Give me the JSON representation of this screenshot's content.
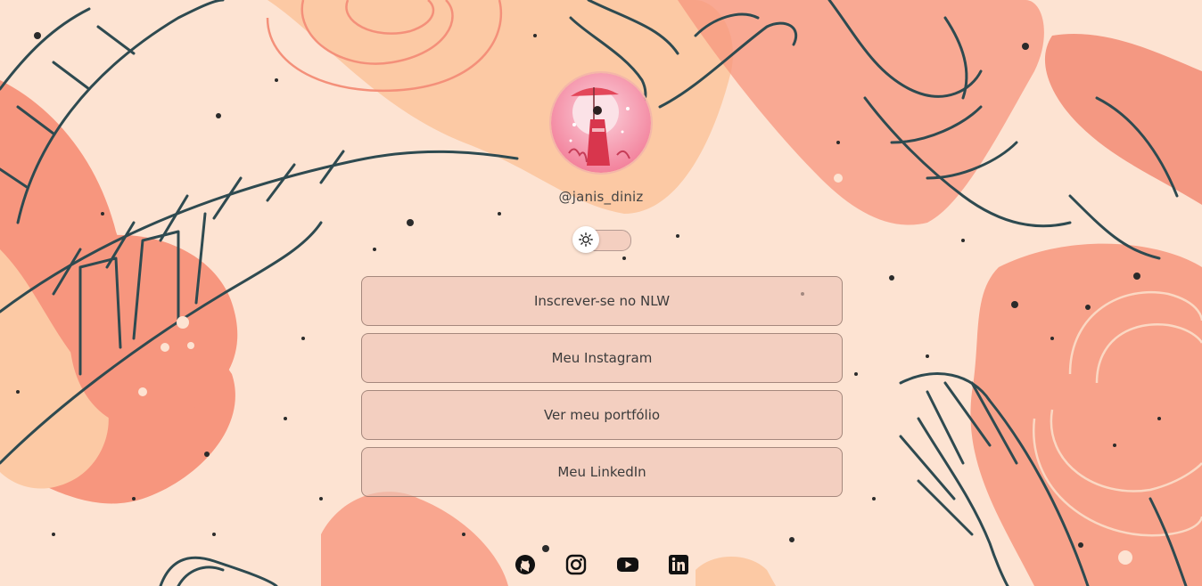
{
  "profile": {
    "username": "@janis_diniz",
    "avatar_alt": "Avatar"
  },
  "theme_switch": {
    "icon": "sun-icon",
    "state": "light"
  },
  "links": [
    {
      "label": "Inscrever-se no NLW"
    },
    {
      "label": "Meu Instagram"
    },
    {
      "label": "Ver meu portfólio"
    },
    {
      "label": "Meu LinkedIn"
    }
  ],
  "social": [
    {
      "icon": "github-icon"
    },
    {
      "icon": "instagram-icon"
    },
    {
      "icon": "youtube-icon"
    },
    {
      "icon": "linkedin-icon"
    }
  ],
  "colors": {
    "background": "#fde3d2",
    "coral": "#f7967e",
    "peach": "#fcc9a4",
    "leaf_stroke": "#2e4a50",
    "button_bg": "#eec4b4"
  }
}
